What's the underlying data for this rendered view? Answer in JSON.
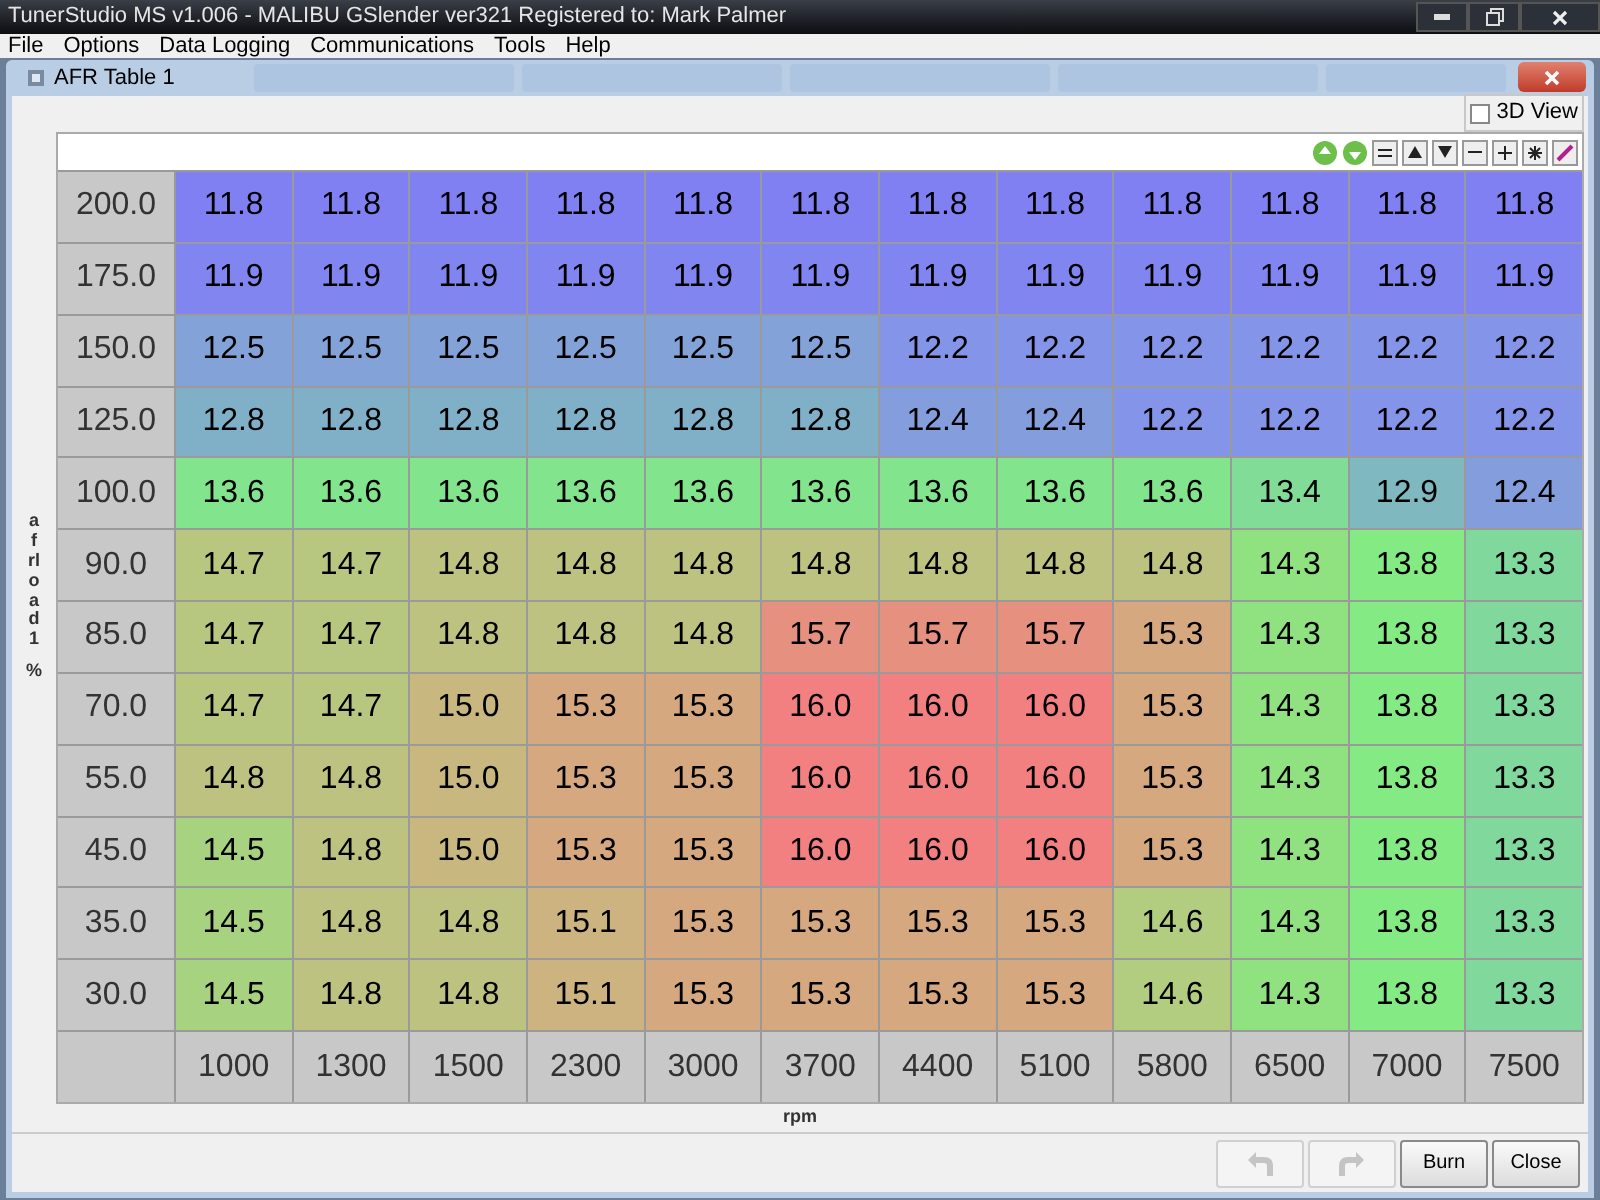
{
  "window": {
    "title": "TunerStudio MS v1.006 - MALIBU GSlender ver321 Registered to: Mark Palmer"
  },
  "menu": [
    "File",
    "Options",
    "Data Logging",
    "Communications",
    "Tools",
    "Help"
  ],
  "dialog": {
    "title": "AFR Table 1",
    "view_3d": {
      "label": "3D View",
      "checked": false
    }
  },
  "table": {
    "y_axis_label": "afrload1",
    "y_axis_unit": "%",
    "x_axis_label": "rpm",
    "x_values": [
      "1000",
      "1300",
      "1500",
      "2300",
      "3000",
      "3700",
      "4400",
      "5100",
      "5800",
      "6500",
      "7000",
      "7500"
    ],
    "rows": [
      {
        "load": "200.0",
        "cells": [
          "11.8",
          "11.8",
          "11.8",
          "11.8",
          "11.8",
          "11.8",
          "11.8",
          "11.8",
          "11.8",
          "11.8",
          "11.8",
          "11.8"
        ]
      },
      {
        "load": "175.0",
        "cells": [
          "11.9",
          "11.9",
          "11.9",
          "11.9",
          "11.9",
          "11.9",
          "11.9",
          "11.9",
          "11.9",
          "11.9",
          "11.9",
          "11.9"
        ]
      },
      {
        "load": "150.0",
        "cells": [
          "12.5",
          "12.5",
          "12.5",
          "12.5",
          "12.5",
          "12.5",
          "12.2",
          "12.2",
          "12.2",
          "12.2",
          "12.2",
          "12.2"
        ]
      },
      {
        "load": "125.0",
        "cells": [
          "12.8",
          "12.8",
          "12.8",
          "12.8",
          "12.8",
          "12.8",
          "12.4",
          "12.4",
          "12.2",
          "12.2",
          "12.2",
          "12.2"
        ]
      },
      {
        "load": "100.0",
        "cells": [
          "13.6",
          "13.6",
          "13.6",
          "13.6",
          "13.6",
          "13.6",
          "13.6",
          "13.6",
          "13.6",
          "13.4",
          "12.9",
          "12.4"
        ]
      },
      {
        "load": "90.0",
        "cells": [
          "14.7",
          "14.7",
          "14.8",
          "14.8",
          "14.8",
          "14.8",
          "14.8",
          "14.8",
          "14.8",
          "14.3",
          "13.8",
          "13.3"
        ]
      },
      {
        "load": "85.0",
        "cells": [
          "14.7",
          "14.7",
          "14.8",
          "14.8",
          "14.8",
          "15.7",
          "15.7",
          "15.7",
          "15.3",
          "14.3",
          "13.8",
          "13.3"
        ]
      },
      {
        "load": "70.0",
        "cells": [
          "14.7",
          "14.7",
          "15.0",
          "15.3",
          "15.3",
          "16.0",
          "16.0",
          "16.0",
          "15.3",
          "14.3",
          "13.8",
          "13.3"
        ]
      },
      {
        "load": "55.0",
        "cells": [
          "14.8",
          "14.8",
          "15.0",
          "15.3",
          "15.3",
          "16.0",
          "16.0",
          "16.0",
          "15.3",
          "14.3",
          "13.8",
          "13.3"
        ]
      },
      {
        "load": "45.0",
        "cells": [
          "14.5",
          "14.8",
          "15.0",
          "15.3",
          "15.3",
          "16.0",
          "16.0",
          "16.0",
          "15.3",
          "14.3",
          "13.8",
          "13.3"
        ]
      },
      {
        "load": "35.0",
        "cells": [
          "14.5",
          "14.8",
          "14.8",
          "15.1",
          "15.3",
          "15.3",
          "15.3",
          "15.3",
          "14.6",
          "14.3",
          "13.8",
          "13.3"
        ]
      },
      {
        "load": "30.0",
        "cells": [
          "14.5",
          "14.8",
          "14.8",
          "15.1",
          "15.3",
          "15.3",
          "15.3",
          "15.3",
          "14.6",
          "14.3",
          "13.8",
          "13.3"
        ]
      }
    ]
  },
  "buttons": [
    {
      "kind": "undo",
      "disabled": true
    },
    {
      "kind": "redo",
      "disabled": true
    },
    {
      "kind": "text",
      "label": "Burn",
      "disabled": false
    },
    {
      "kind": "text",
      "label": "Close",
      "disabled": false
    }
  ]
}
